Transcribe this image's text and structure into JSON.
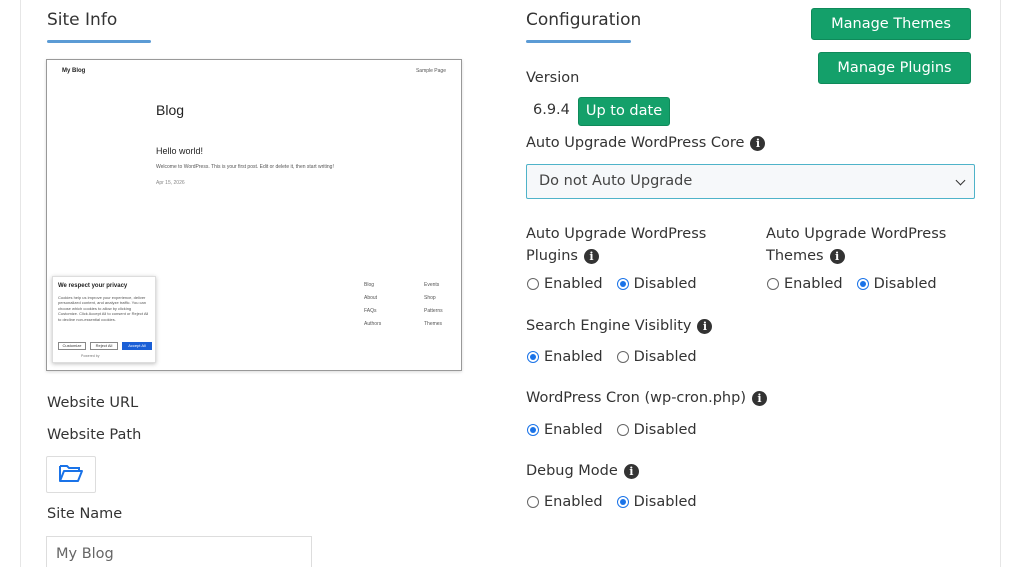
{
  "site_info": {
    "title": "Site Info",
    "preview": {
      "site_name": "My Blog",
      "sample_page": "Sample Page",
      "blog_heading": "Blog",
      "post_title": "Hello world!",
      "post_excerpt": "Welcome to WordPress. This is your first post. Edit or delete it, then start writing!",
      "post_date": "Apr 15, 2026",
      "footer_links_col1": [
        "Blog",
        "About",
        "FAQs",
        "Authors"
      ],
      "footer_links_col2": [
        "Events",
        "Shop",
        "Patterns",
        "Themes"
      ],
      "cookie": {
        "title": "We respect your privacy",
        "text": "Cookies help us improve your experience, deliver personalized content, and analyze traffic. You can choose which cookies to allow by clicking Customize. Click Accept All to consent or Reject All to decline non-essential cookies.",
        "customize": "Customize",
        "reject": "Reject All",
        "accept": "Accept All",
        "powered": "Powered by"
      }
    },
    "website_url_label": "Website URL",
    "website_path_label": "Website Path",
    "site_name_label": "Site Name",
    "site_name_value": "My Blog"
  },
  "configuration": {
    "title": "Configuration",
    "manage_themes": "Manage Themes",
    "manage_plugins": "Manage Plugins",
    "version_label": "Version",
    "version_value": "6.9.4",
    "up_to_date": "Up to date",
    "auto_upgrade_core_label": "Auto Upgrade WordPress Core",
    "auto_upgrade_core_selected": "Do not Auto Upgrade",
    "auto_upgrade_plugins_label_1": "Auto Upgrade WordPress",
    "auto_upgrade_plugins_label_2": "Plugins",
    "auto_upgrade_themes_label_1": "Auto Upgrade WordPress",
    "auto_upgrade_themes_label_2": "Themes",
    "search_engine_label": "Search Engine Visiblity",
    "cron_label": "WordPress Cron (wp-cron.php)",
    "debug_label": "Debug Mode",
    "enabled": "Enabled",
    "disabled": "Disabled",
    "states": {
      "plugins": "Disabled",
      "themes": "Disabled",
      "search_engine": "Enabled",
      "cron": "Enabled",
      "debug": "Disabled"
    }
  },
  "colors": {
    "accent_green": "#14a06a",
    "underline_blue": "#5b9bd5",
    "radio_blue": "#1a73e8"
  }
}
